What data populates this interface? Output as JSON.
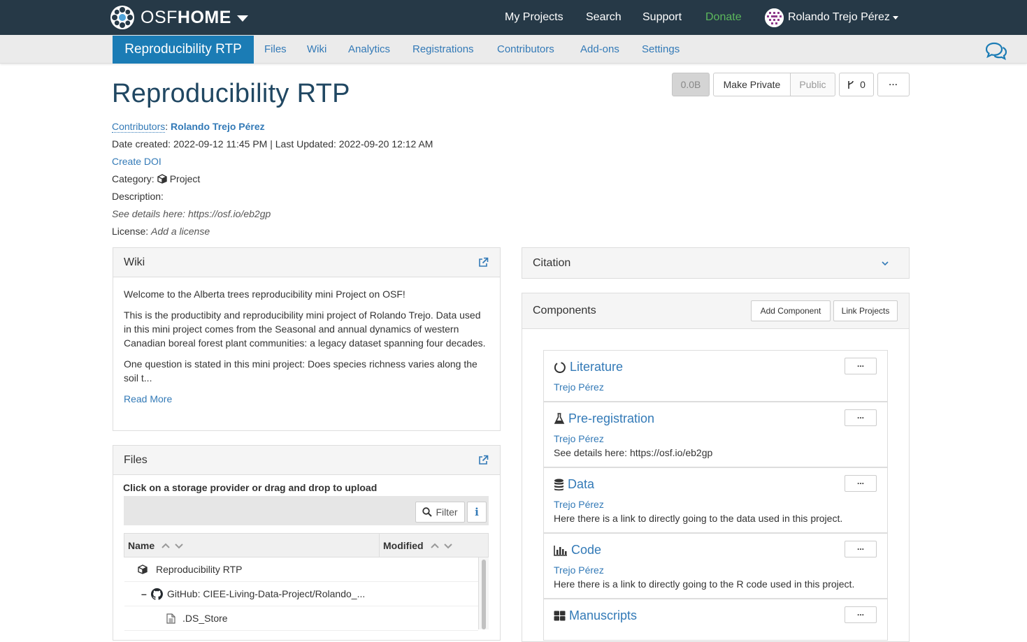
{
  "topbar": {
    "brand_light": "OSF",
    "brand_bold": "HOME",
    "nav": [
      "My Projects",
      "Search",
      "Support",
      "Donate"
    ],
    "user_name": "Rolando Trejo Pérez"
  },
  "project_nav": {
    "active": "Reproducibility RTP",
    "tabs": [
      "Files",
      "Wiki",
      "Analytics",
      "Registrations",
      "Contributors",
      "Add-ons",
      "Settings"
    ]
  },
  "toolbar": {
    "size": "0.0B",
    "make_private": "Make Private",
    "public": "Public",
    "forks": "0"
  },
  "project": {
    "title": "Reproducibility RTP",
    "contributors_label": "Contributors",
    "contributor": "Rolando Trejo Pérez",
    "dates": "Date created: 2022-09-12 11:45 PM | Last Updated: 2022-09-20 12:12 AM",
    "create_doi": "Create DOI",
    "category_label": "Category:",
    "category": "Project",
    "description_label": "Description:",
    "description": "See details here: https://osf.io/eb2gp",
    "license_label": "License:",
    "license": "Add a license"
  },
  "wiki": {
    "title": "Wiki",
    "p1": "Welcome to the Alberta trees reproducibility mini Project on OSF!",
    "p2": "This is the productibity and reproducibility mini project of Rolando Trejo. Data used in this mini project comes from the Seasonal and annual dynamics of western Canadian boreal forest plant communities: a legacy dataset spanning four decades.",
    "p3": "One question is stated in this mini project: Does species richness varies along the soil t...",
    "read_more": "Read More"
  },
  "files": {
    "title": "Files",
    "instruction": "Click on a storage provider or drag and drop to upload",
    "filter": "Filter",
    "col_name": "Name",
    "col_modified": "Modified",
    "rows": [
      "Reproducibility RTP",
      "GitHub: CIEE-Living-Data-Project/Rolando_...",
      ".DS_Store"
    ]
  },
  "citation": {
    "title": "Citation"
  },
  "components": {
    "title": "Components",
    "add": "Add Component",
    "link": "Link Projects",
    "items": [
      {
        "title": "Literature",
        "author": "Trejo Pérez",
        "desc": "",
        "icon": "circle-notch-icon"
      },
      {
        "title": "Pre-registration",
        "author": "Trejo Pérez",
        "desc": "See details here: https://osf.io/eb2gp",
        "icon": "flask-icon"
      },
      {
        "title": "Data",
        "author": "Trejo Pérez",
        "desc": "Here there is a link to directly going to the data used in this project.",
        "icon": "database-icon"
      },
      {
        "title": "Code",
        "author": "Trejo Pérez",
        "desc": "Here there is a link to directly going to the R code used in this project.",
        "icon": "bar-chart-icon"
      },
      {
        "title": "Manuscripts",
        "author": "",
        "desc": "",
        "icon": "grid-icon"
      }
    ]
  }
}
